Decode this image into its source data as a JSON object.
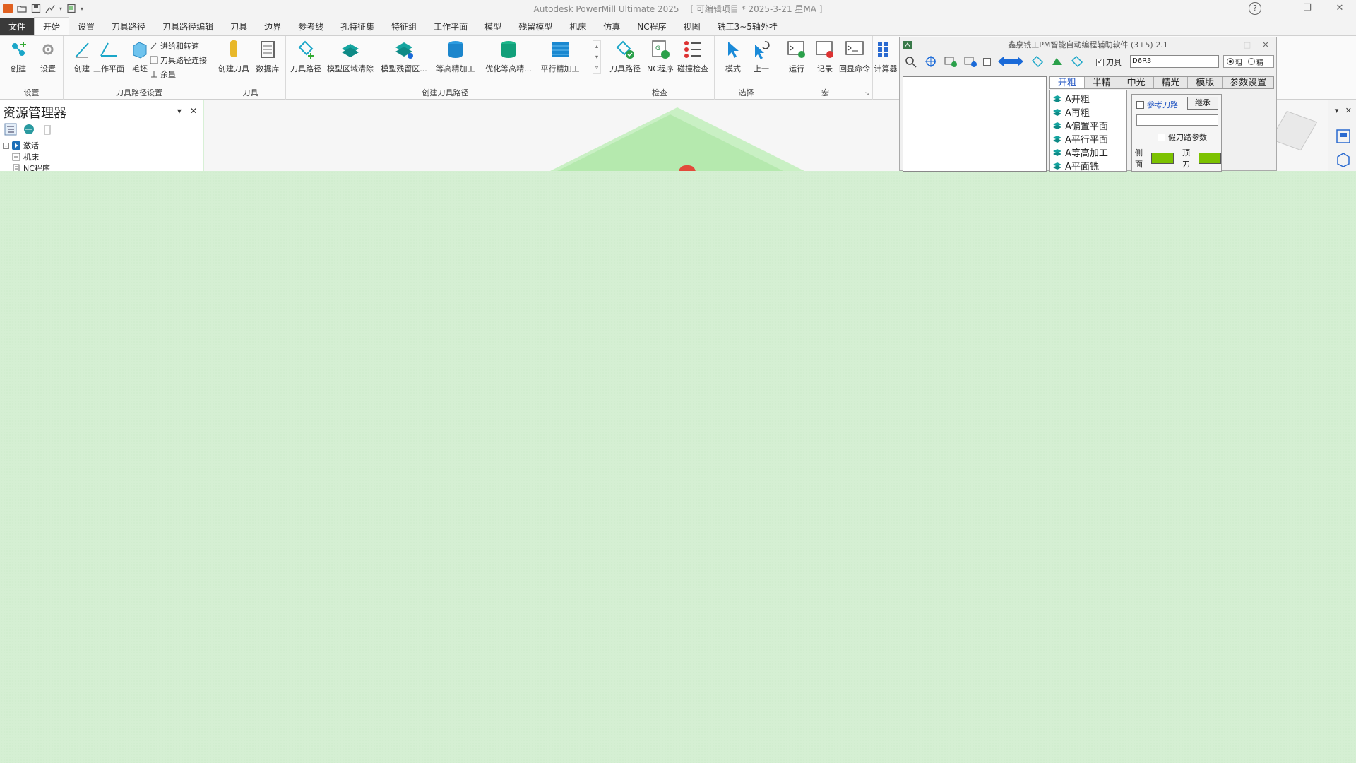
{
  "titlebar": {
    "title": "Autodesk PowerMill Ultimate 2025",
    "subtitle": "[ 可编辑项目 * 2025-3-21 星MA ]",
    "help": "?",
    "minimize": "—",
    "restore": "❐",
    "close": "✕"
  },
  "tabs": [
    "文件",
    "开始",
    "设置",
    "刀具路径",
    "刀具路径编辑",
    "刀具",
    "边界",
    "参考线",
    "孔特征集",
    "特征组",
    "工作平面",
    "模型",
    "残留模型",
    "机床",
    "仿真",
    "NC程序",
    "视图",
    "铣工3~5轴外挂"
  ],
  "ribbon": {
    "groups": {
      "setup": "设置",
      "toolpath_setup": "刀具路径设置",
      "tool": "刀具",
      "create_toolpath": "创建刀具路径",
      "verify": "检查",
      "select": "选择",
      "macro": "宏"
    },
    "buttons": {
      "create": "创建",
      "setup_btn": "设置",
      "create2": "创建",
      "workplane": "工作平面",
      "block": "毛坯",
      "leads_links": "进给和转速",
      "toolpath_connect": "刀具路径连接",
      "allowance": "余量",
      "create_tool": "创建刀具",
      "database": "数据库",
      "toolpath": "刀具路径",
      "model_area_clear": "模型区域清除",
      "model_rest": "模型残留区...",
      "constant_z": "等高精加工",
      "optimized_z": "优化等高精...",
      "raster": "平行精加工",
      "toolpath_verify": "刀具路径",
      "nc_verify": "NC程序",
      "collision": "碰撞检查",
      "mode": "模式",
      "undo_select": "上一",
      "run": "运行",
      "record": "记录",
      "echo": "回显命令",
      "calc": "计算器"
    }
  },
  "explorer": {
    "title": "资源管理器",
    "pin": "▾",
    "close": "✕",
    "tree": [
      {
        "label": "激活",
        "expander": "-"
      },
      {
        "label": "机床",
        "expander": ""
      },
      {
        "label": "NC程序",
        "expander": ""
      }
    ]
  },
  "right_panel": {
    "pin": "▾",
    "close": "✕"
  },
  "dialog": {
    "title": "鑫泉铣工PM智能自动编程辅助软件 (3+5) 2.1",
    "close": "✕",
    "restore": "□",
    "tool_label": "刀具",
    "tool_value": "D6R3",
    "radio_rough": "粗",
    "radio_finish": "精",
    "tabs": [
      "开粗",
      "半精",
      "中光",
      "精光",
      "模版",
      "参数设置"
    ],
    "operations": [
      "A开粗",
      "A再粗",
      "A偏置平面",
      "A平行平面",
      "A等高加工",
      "A平面铣"
    ],
    "ref_toolpath": "参考刀路",
    "inherit": "继承",
    "fake_params": "假刀路参数",
    "side_label": "侧面",
    "top_label": "顶刀",
    "swatch_color": "#7cc200"
  },
  "colors": {
    "accent": "#1a4fc0",
    "ribbon_icon": "#1aa6c8",
    "workspace": "#d5efd3"
  }
}
